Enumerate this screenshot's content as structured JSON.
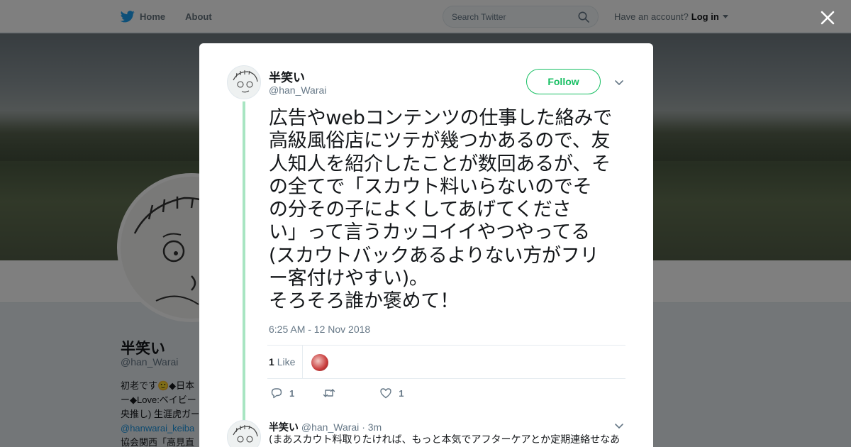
{
  "nav": {
    "home_label": "Home",
    "about_label": "About",
    "search_placeholder": "Search Twitter",
    "have_account": "Have an account?",
    "login_label": "Log in"
  },
  "background_profile": {
    "name": "半笑い",
    "handle": "@han_Warai",
    "bio_lines": [
      "初老です🙂◆日本",
      "ー◆Love:ベイビー",
      "央推し) 生涯虎ガー",
      "@hanwarai_keiba",
      "協会関西「高見直"
    ]
  },
  "tweet": {
    "author_name": "半笑い",
    "author_handle": "@han_Warai",
    "follow_label": "Follow",
    "text_lines": [
      "広告やwebコンテンツの仕事した絡みで",
      "高級風俗店にツテが幾つかあるので、友",
      "人知人を紹介したことが数回あるが、そ",
      "の全てで「スカウト料いらないのでそ",
      "の分その子によくしてあげてくださ",
      "い」って言うカッコイイやつやってる",
      "(スカウトバックあるよりない方がフリ",
      "ー客付けやすい)。",
      "そろそろ誰か褒めて！"
    ],
    "timestamp": "6:25 AM - 12 Nov 2018",
    "likes_count": "1",
    "likes_label": "Like",
    "reply_count": "1",
    "like_action_count": "1"
  },
  "reply": {
    "author_name": "半笑い",
    "author_handle": "@han_Warai",
    "time": "· 3m",
    "text": "(まあスカウト料取りたければ、もっと本気でアフターケアとか定期連絡せなあ"
  },
  "colors": {
    "accent_green": "#17bf63",
    "thread_line": "#a8e5c2",
    "twitter_blue": "#1da1f2"
  }
}
